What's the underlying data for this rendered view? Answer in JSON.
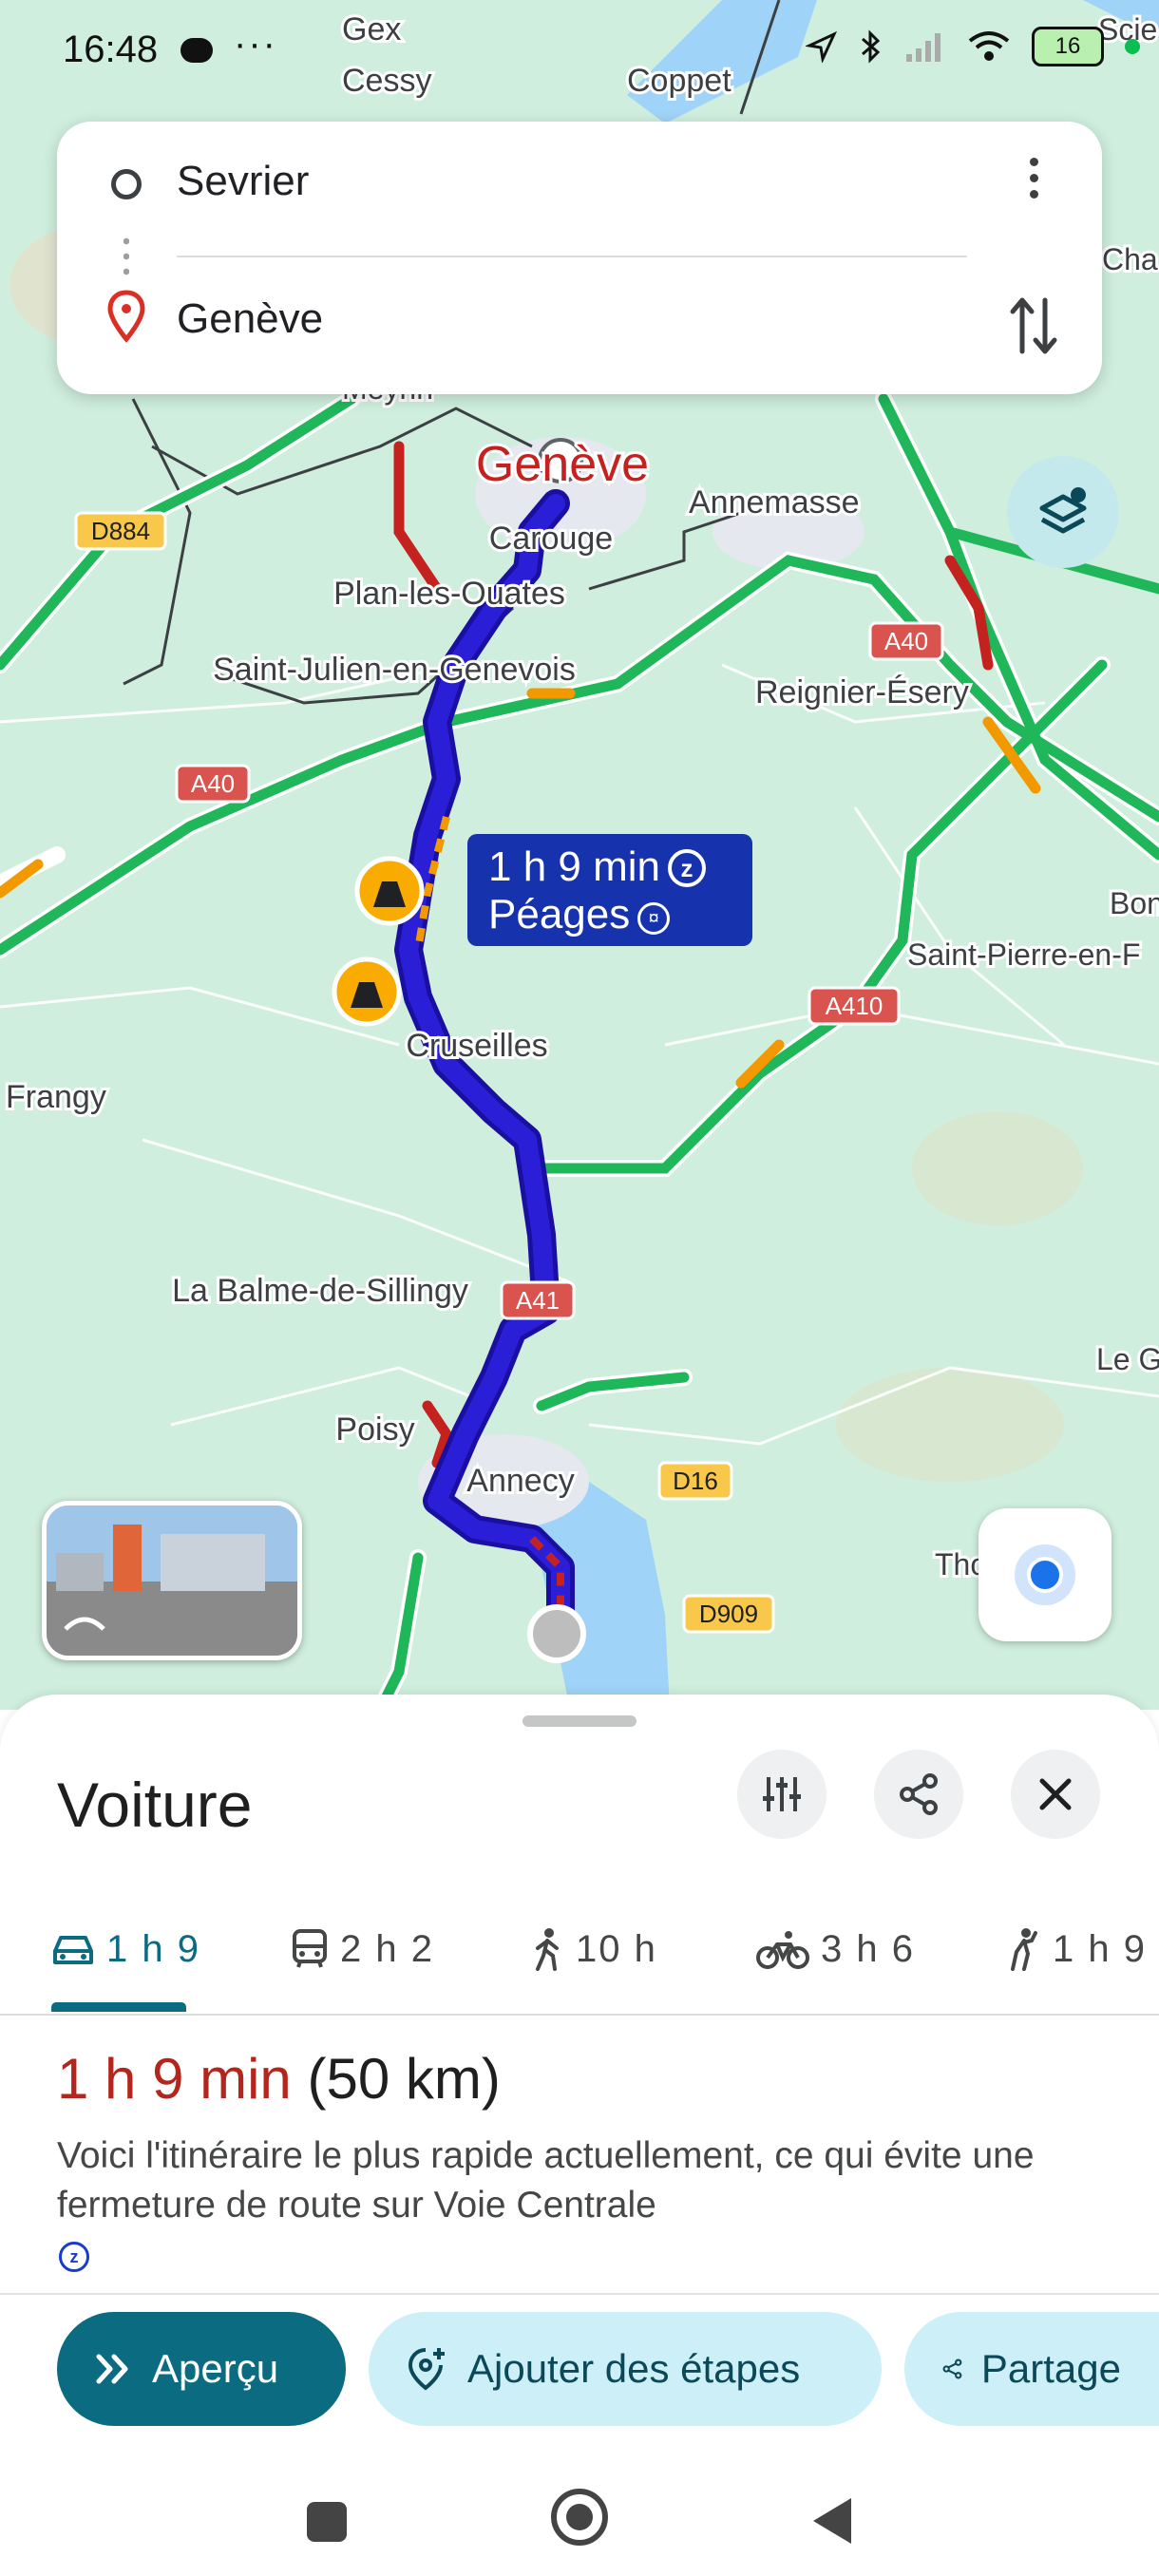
{
  "status_bar": {
    "time": "16:48",
    "dots": "···",
    "battery": "16"
  },
  "search": {
    "origin": "Sevrier",
    "destination": "Genève"
  },
  "map": {
    "places": [
      {
        "name": "Gex"
      },
      {
        "name": "Cessy"
      },
      {
        "name": "Coppet"
      },
      {
        "name": "Meyrin"
      },
      {
        "name": "Genève"
      },
      {
        "name": "Carouge"
      },
      {
        "name": "Annemasse"
      },
      {
        "name": "Plan-les-Ouates"
      },
      {
        "name": "Saint-Julien-en-Genevois"
      },
      {
        "name": "Reignier-Ésery"
      },
      {
        "name": "Saint-Pierre-en-F"
      },
      {
        "name": "Cruseilles"
      },
      {
        "name": "Frangy"
      },
      {
        "name": "La Balme-de-Sillingy"
      },
      {
        "name": "Poisy"
      },
      {
        "name": "Annecy"
      },
      {
        "name": "Le G"
      },
      {
        "name": "Tho"
      },
      {
        "name": "Scie"
      },
      {
        "name": "Cha"
      },
      {
        "name": "Bon"
      }
    ],
    "road_shields": [
      {
        "label": "D884",
        "type": "departmental"
      },
      {
        "label": "A40",
        "type": "motorway"
      },
      {
        "label": "A40",
        "type": "motorway"
      },
      {
        "label": "A410",
        "type": "motorway"
      },
      {
        "label": "A41",
        "type": "motorway"
      },
      {
        "label": "D16",
        "type": "departmental"
      },
      {
        "label": "D909",
        "type": "departmental"
      }
    ],
    "route_label": {
      "duration": "1 h 9 min",
      "tolls": "Péages",
      "zone_badge": "z"
    },
    "icons": [
      "construction-icon",
      "layers-icon",
      "my-location-icon"
    ],
    "colors": {
      "route": "#2a1fd6",
      "route_casing": "#1a0fa0",
      "traffic_red": "#c5221f",
      "traffic_orange": "#f29900",
      "highway_green": "#1fb75a",
      "land": "#cfeedd"
    }
  },
  "sheet": {
    "mode": "Voiture",
    "tabs": [
      {
        "icon": "car-icon",
        "label": "1 h 9",
        "active": true
      },
      {
        "icon": "transit-icon",
        "label": "2 h 2",
        "active": false
      },
      {
        "icon": "walk-icon",
        "label": "10 h",
        "active": false
      },
      {
        "icon": "bike-icon",
        "label": "3 h 6",
        "active": false
      },
      {
        "icon": "ride-icon",
        "label": "1 h 9",
        "active": false
      }
    ],
    "duration": "1 h 9 min",
    "distance": "(50 km)",
    "description": "Voici l'itinéraire le plus rapide actuellement, ce qui évite une fermeture de route sur Voie Centrale",
    "zone_badge": "z",
    "buttons": {
      "overview": "Aperçu",
      "add_stops": "Ajouter des étapes",
      "share": "Partage"
    },
    "accent_color": "#0b6b80",
    "duration_color": "#b3261e"
  }
}
